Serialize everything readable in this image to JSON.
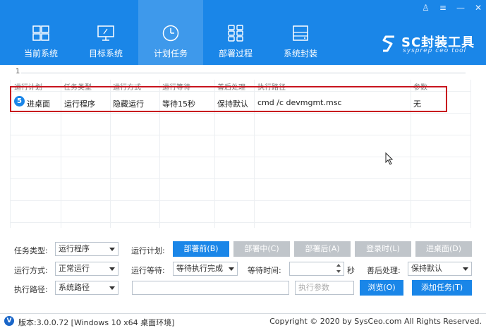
{
  "window": {
    "controls": [
      "♙",
      "≡",
      "—",
      "✕"
    ]
  },
  "nav": [
    {
      "label": "当前系统",
      "icon": "windows-icon"
    },
    {
      "label": "目标系统",
      "icon": "monitor-icon"
    },
    {
      "label": "计划任务",
      "icon": "clock-icon",
      "active": true
    },
    {
      "label": "部署过程",
      "icon": "grid-icon"
    },
    {
      "label": "系统封装",
      "icon": "drive-icon"
    }
  ],
  "logo": {
    "title": "SC封装工具",
    "subtitle": "sysprep ceo tool"
  },
  "pagination": {
    "page": "1"
  },
  "table": {
    "headers": [
      "运行计划",
      "任务类型",
      "运行方式",
      "运行等待",
      "善后处理",
      "执行路径",
      "参数"
    ],
    "rows": [
      {
        "num": "5",
        "plan": "进桌面",
        "type": "运行程序",
        "mode": "隐藏运行",
        "wait": "等待15秒",
        "after": "保持默认",
        "path": "cmd /c devmgmt.msc",
        "param": "无"
      }
    ]
  },
  "form": {
    "task_type_label": "任务类型:",
    "task_type_value": "运行程序",
    "run_plan_label": "运行计划:",
    "plan_buttons": [
      "部署前(B)",
      "部署中(C)",
      "部署后(A)",
      "登录时(L)",
      "进桌面(D)"
    ],
    "run_mode_label": "运行方式:",
    "run_mode_value": "正常运行",
    "run_wait_label": "运行等待:",
    "run_wait_value": "等待执行完成",
    "wait_time_label": "等待时间:",
    "wait_time_unit": "秒",
    "after_label": "善后处理:",
    "after_value": "保持默认",
    "exec_path_label": "执行路径:",
    "exec_path_value": "系统路径",
    "param_placeholder": "执行参数",
    "browse_label": "浏览(O)",
    "add_task_label": "添加任务(T)"
  },
  "footer": {
    "version": "版本:3.0.0.72 [Windows 10 x64 桌面环境]",
    "copyright": "Copyright © 2020 by SysCeo.com All Rights Reserved."
  },
  "colors": {
    "accent": "#1a86e8",
    "highlight": "#c8141e",
    "disabled": "#c0c5ca"
  }
}
